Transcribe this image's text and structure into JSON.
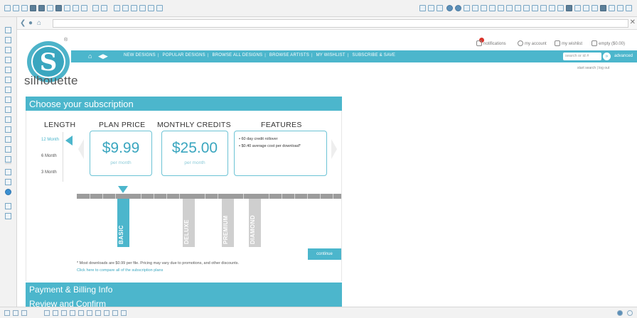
{
  "logo": {
    "letter": "S",
    "name": "silhouette",
    "reg": "®"
  },
  "account": {
    "notifications": "notifications",
    "my_account": "my account",
    "my_wishlist": "my wishlist",
    "cart": "empty ($0.00)"
  },
  "nav": {
    "home_icon": "⌂",
    "toggle_icon": "◀▶",
    "links": [
      "NEW DESIGNS",
      "POPULAR DESIGNS",
      "BROWSE ALL DESIGNS",
      "BROWSE ARTISTS",
      "MY WISHLIST",
      "SUBSCRIBE & SAVE"
    ],
    "search_placeholder": "search or id #",
    "search_button": "»",
    "advanced": "advanced"
  },
  "sub_links": "start search | log out",
  "subscription": {
    "title": "Choose your subscription",
    "headers": {
      "length": "LENGTH",
      "plan_price": "PLAN PRICE",
      "monthly_credits": "MONTHLY CREDITS",
      "features": "FEATURES"
    },
    "lengths": [
      "12 Month",
      "6 Month",
      "3 Month"
    ],
    "plan_price": {
      "value": "$9.99",
      "sub": "per month"
    },
    "monthly_credits": {
      "value": "$25.00",
      "sub": "per month"
    },
    "features": [
      "60 day credit rollover",
      "$0.40 average cost per download*"
    ],
    "tiers": [
      "BASIC",
      "DELUXE",
      "PREMIUM",
      "DIAMOND"
    ],
    "continue_label": "continue",
    "footnote": "* Most downloads are $0.99 per file. Pricing may vary due to promotions, and other discounts.",
    "compare_link": "Click here to compare all of the subscription plans"
  },
  "sections": {
    "payment": "Payment & Billing Info",
    "review": "Review and Confirm"
  },
  "colors": {
    "accent": "#4cb6cc",
    "accent_dark": "#3aa6bf",
    "tier_inactive": "#cfcfcf"
  }
}
